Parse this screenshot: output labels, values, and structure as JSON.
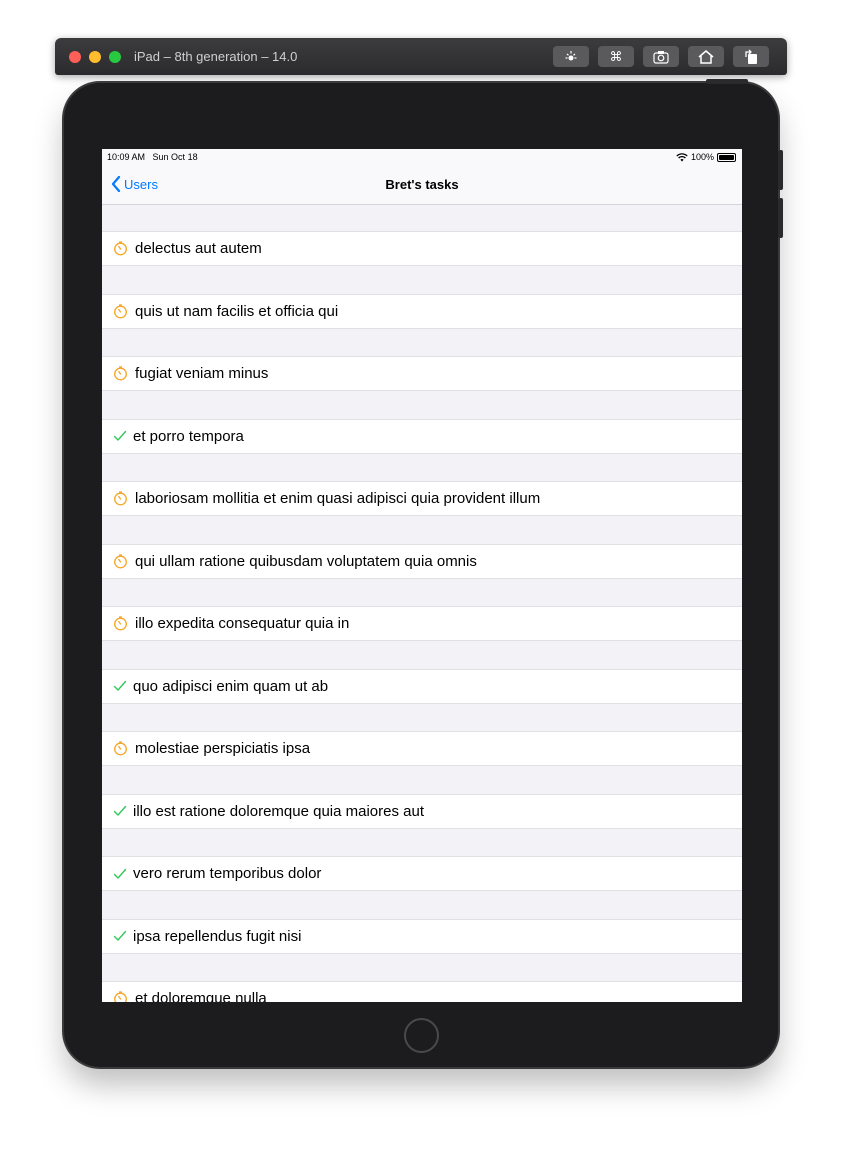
{
  "simulator": {
    "title": "iPad – 8th generation – 14.0",
    "toolbar_icons": [
      "brightness-icon",
      "command-icon",
      "screenshot-icon",
      "home-icon",
      "rotate-icon"
    ]
  },
  "status_bar": {
    "time": "10:09 AM",
    "date": "Sun Oct 18",
    "battery": "100%"
  },
  "nav": {
    "back_label": "Users",
    "title": "Bret's tasks"
  },
  "colors": {
    "accent": "#007aff",
    "pending": "#f5a623",
    "done": "#34c759"
  },
  "tasks": [
    {
      "title": "delectus aut autem",
      "status": "pending"
    },
    {
      "title": "quis ut nam facilis et officia qui",
      "status": "pending"
    },
    {
      "title": "fugiat veniam minus",
      "status": "pending"
    },
    {
      "title": "et porro tempora",
      "status": "done"
    },
    {
      "title": "laboriosam mollitia et enim quasi adipisci quia provident illum",
      "status": "pending"
    },
    {
      "title": "qui ullam ratione quibusdam voluptatem quia omnis",
      "status": "pending"
    },
    {
      "title": "illo expedita consequatur quia in",
      "status": "pending"
    },
    {
      "title": "quo adipisci enim quam ut ab",
      "status": "done"
    },
    {
      "title": "molestiae perspiciatis ipsa",
      "status": "pending"
    },
    {
      "title": "illo est ratione doloremque quia maiores aut",
      "status": "done"
    },
    {
      "title": "vero rerum temporibus dolor",
      "status": "done"
    },
    {
      "title": "ipsa repellendus fugit nisi",
      "status": "done"
    },
    {
      "title": "et doloremque nulla",
      "status": "pending"
    }
  ]
}
